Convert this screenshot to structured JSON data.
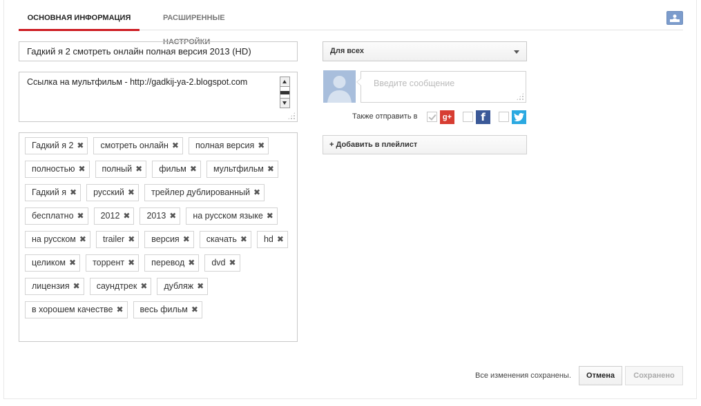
{
  "tabs": [
    {
      "label": "ОСНОВНАЯ ИНФОРМАЦИЯ",
      "active": true
    },
    {
      "label": "РАСШИРЕННЫЕ НАСТРОЙКИ",
      "active": false
    }
  ],
  "video": {
    "title": "Гадкий я 2 смотреть онлайн полная версия 2013 (HD)",
    "description": "Ссылка на мультфильм - http://gadkij-ya-2.blogspot.com"
  },
  "tags": [
    "Гадкий я 2",
    "смотреть онлайн",
    "полная версия",
    "полностью",
    "полный",
    "фильм",
    "мультфильм",
    "Гадкий я",
    "русский",
    "трейлер дублированный",
    "бесплатно",
    "2012",
    "2013",
    "на русском языке",
    "на русском",
    "trailer",
    "версия",
    "скачать",
    "hd",
    "целиком",
    "торрент",
    "перевод",
    "dvd",
    "лицензия",
    "саундтрек",
    "дубляж",
    "в хорошем качестве",
    "весь фильм"
  ],
  "tag_remove_glyph": "✖",
  "privacy": {
    "selected": "Для всех"
  },
  "message": {
    "placeholder": "Введите сообщение"
  },
  "share": {
    "label": "Также отправить в",
    "networks": [
      {
        "name": "google-plus",
        "glyph": "g+",
        "color": "#d73d32",
        "checked": true
      },
      {
        "name": "facebook",
        "glyph": "f",
        "color": "#3b5998",
        "checked": false
      },
      {
        "name": "twitter",
        "glyph": "",
        "color": "#2ba9e1",
        "checked": false
      }
    ]
  },
  "playlist": {
    "label": "+ Добавить в плейлист"
  },
  "footer": {
    "status": "Все изменения сохранены.",
    "cancel_label": "Отмена",
    "saved_label": "Сохранено"
  }
}
